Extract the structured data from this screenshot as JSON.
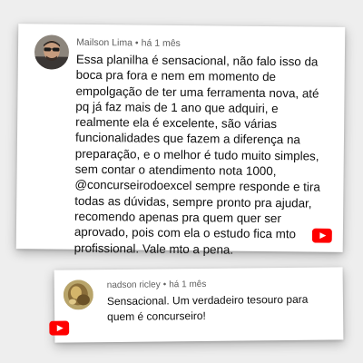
{
  "comments": [
    {
      "author": "Mailson Lima",
      "separator": "•",
      "time": "há 1 mês",
      "text": "Essa planilha é sensacional, não falo isso da boca pra fora e nem em momento de empolgação de ter uma ferramenta nova, até pq já faz mais de 1 ano que adquiri, e realmente ela é excelente, são várias funcionalidades que fazem a diferença na preparação, e o melhor é tudo muito simples, sem contar o atendimento nota 1000, @concurseirodoexcel sempre responde e tira todas as dúvidas, sempre pronto pra ajudar, recomendo apenas pra quem quer ser aprovado, pois com ela o estudo fica mto profissional. Vale mto a pena."
    },
    {
      "author": "nadson ricley",
      "separator": "•",
      "time": "há 1 mês",
      "text": "Sensacional. Um verdadeiro tesouro para quem é concurseiro!"
    }
  ],
  "colors": {
    "youtube_red": "#ff0000",
    "meta_text": "#606060",
    "body_text": "#0f0f0f",
    "background": "#eeeeee"
  },
  "icons": {
    "brand": "youtube-icon"
  }
}
